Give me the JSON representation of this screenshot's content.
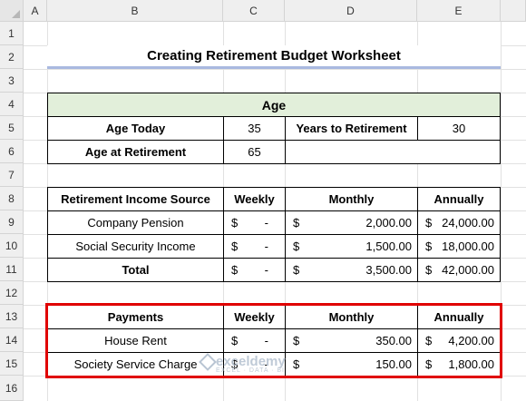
{
  "columns": [
    "A",
    "B",
    "C",
    "D",
    "E"
  ],
  "rows": [
    "1",
    "2",
    "3",
    "4",
    "5",
    "6",
    "7",
    "8",
    "9",
    "10",
    "11",
    "12",
    "13",
    "14",
    "15",
    "16"
  ],
  "title": "Creating Retirement Budget Worksheet",
  "age": {
    "header": "Age",
    "age_today_label": "Age Today",
    "age_today": "35",
    "years_to_retirement_label": "Years to Retirement",
    "years_to_retirement": "30",
    "age_at_retirement_label": "Age at Retirement",
    "age_at_retirement": "65"
  },
  "income": {
    "headers": [
      "Retirement Income Source",
      "Weekly",
      "Monthly",
      "Annually"
    ],
    "rows": [
      {
        "label": "Company Pension",
        "weekly": "-",
        "monthly": "2,000.00",
        "annually": "24,000.00"
      },
      {
        "label": "Social Security Income",
        "weekly": "-",
        "monthly": "1,500.00",
        "annually": "18,000.00"
      },
      {
        "label": "Total",
        "weekly": "-",
        "monthly": "3,500.00",
        "annually": "42,000.00"
      }
    ]
  },
  "payments": {
    "headers": [
      "Payments",
      "Weekly",
      "Monthly",
      "Annually"
    ],
    "rows": [
      {
        "label": "House Rent",
        "weekly": "-",
        "monthly": "350.00",
        "annually": "4,200.00"
      },
      {
        "label": "Society Service Charge",
        "weekly": "-",
        "monthly": "150.00",
        "annually": "1,800.00"
      }
    ]
  },
  "currency_symbol": "$",
  "watermark": {
    "name": "exceldemy",
    "tagline": "EXCEL · DATA · BI"
  },
  "colors": {
    "highlight_border": "#e00000",
    "age_header_fill": "#e2efda",
    "title_underline": "#a9b9e0"
  }
}
